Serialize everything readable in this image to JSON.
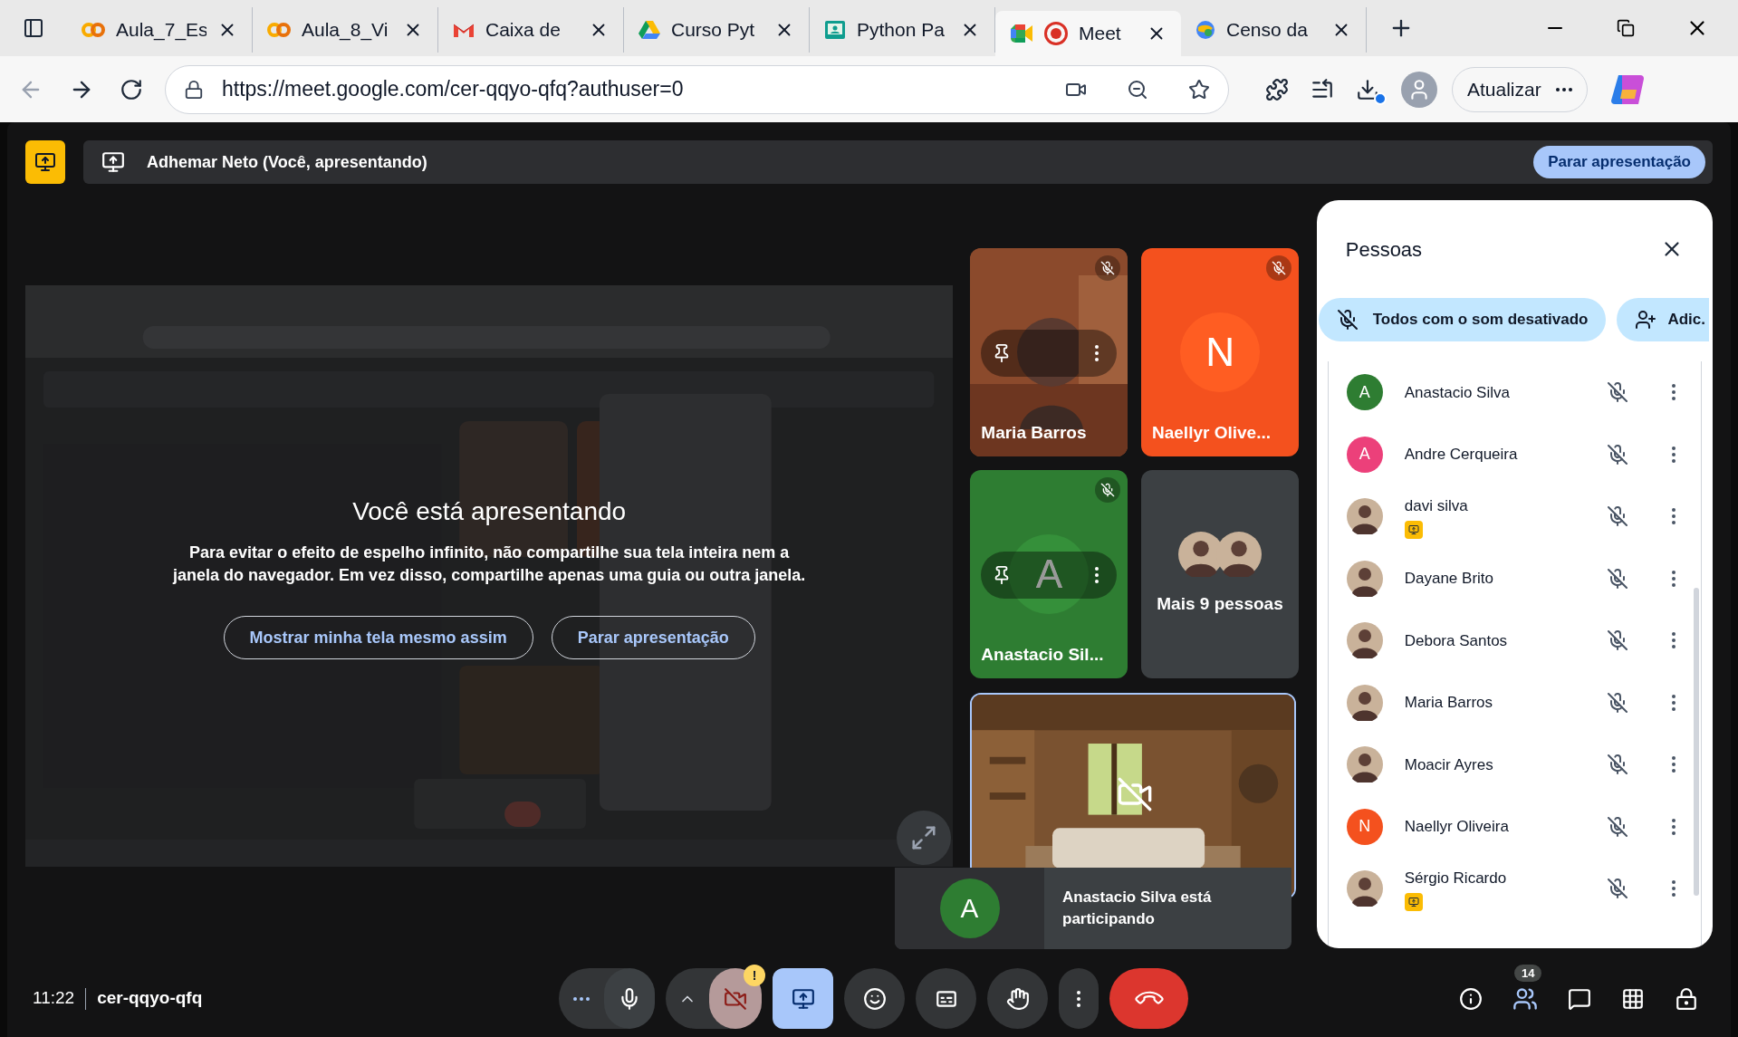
{
  "browser": {
    "tabs": [
      {
        "title": "Aula_7_Es",
        "kind": "colab",
        "selected": false
      },
      {
        "title": "Aula_8_Vi",
        "kind": "colab",
        "selected": false
      },
      {
        "title": "Caixa de",
        "kind": "gmail",
        "selected": false
      },
      {
        "title": "Curso Pyt",
        "kind": "drive",
        "selected": false
      },
      {
        "title": "Python Pa",
        "kind": "classroom",
        "selected": false
      },
      {
        "title": "Meet",
        "kind": "meet",
        "recording": true,
        "selected": true
      },
      {
        "title": "Censo da",
        "kind": "globe",
        "selected": false
      }
    ],
    "url": "https://meet.google.com/cer-qqyo-qfq?authuser=0",
    "update_button": "Atualizar",
    "download_badge": true
  },
  "presenting_bar": {
    "text": "Adhemar Neto (Você, apresentando)",
    "stop_button": "Parar apresentação"
  },
  "stage": {
    "title": "Você está apresentando",
    "message": "Para evitar o efeito de espelho infinito, não compartilhe sua tela inteira nem a janela do navegador. Em vez disso, compartilhe apenas uma guia ou outra janela.",
    "buttons": [
      "Mostrar minha tela mesmo assim",
      "Parar apresentação"
    ]
  },
  "tiles": [
    {
      "kind": "video",
      "name": "Maria Barros",
      "muted": true,
      "hovered": true
    },
    {
      "kind": "initial",
      "name": "Naellyr Olive...",
      "initial": "N",
      "color": "#f4511e",
      "muted": true,
      "hovered": false
    },
    {
      "kind": "initial",
      "name": "Anastacio Sil...",
      "initial": "A",
      "color": "#2e7d32",
      "muted": true,
      "hovered": true
    },
    {
      "kind": "more",
      "name": "Mais 9 pessoas"
    }
  ],
  "self_view": {
    "camera_off": true
  },
  "toast": {
    "initial": "A",
    "color": "#2e7d32",
    "text": "Anastacio Silva está participando"
  },
  "people": {
    "title": "Pessoas",
    "mute_all": "Todos com o som desativado",
    "add": "Adic.",
    "participants": [
      {
        "name": "Anastacio Silva",
        "initial": "A",
        "color": "#2e7d32",
        "muted": true,
        "presenting": false
      },
      {
        "name": "Andre Cerqueira",
        "initial": "A",
        "color": "#ec407a",
        "muted": true,
        "presenting": false
      },
      {
        "name": "davi silva",
        "muted": true,
        "presenting": true
      },
      {
        "name": "Dayane Brito",
        "muted": true,
        "presenting": false
      },
      {
        "name": "Debora Santos",
        "muted": true,
        "presenting": false
      },
      {
        "name": "Maria Barros",
        "muted": true,
        "presenting": false
      },
      {
        "name": "Moacir Ayres",
        "muted": true,
        "presenting": false
      },
      {
        "name": "Naellyr Oliveira",
        "initial": "N",
        "color": "#f4511e",
        "muted": true,
        "presenting": false
      },
      {
        "name": "Sérgio Ricardo",
        "muted": true,
        "presenting": true
      }
    ]
  },
  "bottom": {
    "time": "11:22",
    "code": "cer-qqyo-qfq",
    "mic_on": true,
    "camera_on": false,
    "camera_warning": "!",
    "presenting": true,
    "people_count": "14"
  }
}
